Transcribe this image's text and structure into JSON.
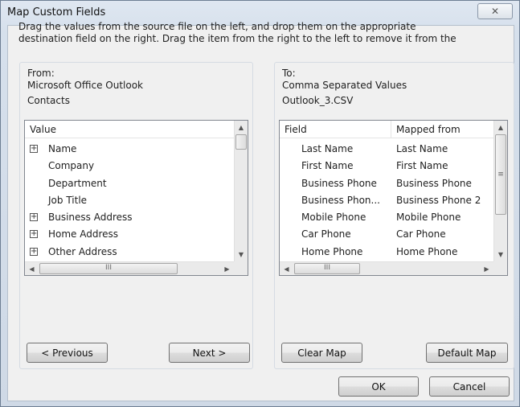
{
  "window": {
    "title": "Map Custom Fields",
    "close_label": "✕"
  },
  "instructions": {
    "line1": "Drag the values from the source file on the left, and drop them on the appropriate",
    "line2": "destination field on the right.  Drag the item from the right to the left to remove it from the"
  },
  "from": {
    "caption": "From:",
    "source": "Microsoft Office Outlook",
    "folder": "Contacts",
    "column_header": "Value",
    "items": [
      {
        "label": "Name",
        "expandable": true
      },
      {
        "label": "Company",
        "expandable": false
      },
      {
        "label": "Department",
        "expandable": false
      },
      {
        "label": "Job Title",
        "expandable": false
      },
      {
        "label": "Business Address",
        "expandable": true
      },
      {
        "label": "Home Address",
        "expandable": true
      },
      {
        "label": "Other Address",
        "expandable": true
      }
    ],
    "hscroll_grip": "III",
    "prev_button": "< Previous",
    "next_button": "Next >"
  },
  "to": {
    "caption": "To:",
    "target": "Comma Separated Values",
    "file": "Outlook_3.CSV",
    "column_headers": [
      "Field",
      "Mapped from"
    ],
    "rows": [
      {
        "field": "Last Name",
        "mapped": "Last Name"
      },
      {
        "field": "First Name",
        "mapped": "First Name"
      },
      {
        "field": "Business Phone",
        "mapped": "Business Phone"
      },
      {
        "field": "Business Phon...",
        "mapped": "Business Phone 2"
      },
      {
        "field": "Mobile Phone",
        "mapped": "Mobile Phone"
      },
      {
        "field": "Car Phone",
        "mapped": "Car Phone"
      },
      {
        "field": "Home Phone",
        "mapped": "Home Phone"
      }
    ],
    "hscroll_grip": "III",
    "vscroll_grip": "≡",
    "clear_button": "Clear Map",
    "default_button": "Default Map"
  },
  "footer": {
    "ok": "OK",
    "cancel": "Cancel"
  }
}
